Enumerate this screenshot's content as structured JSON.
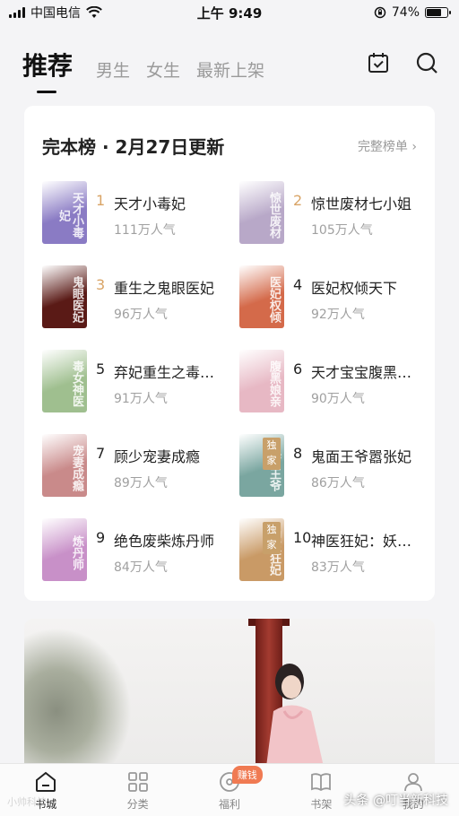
{
  "status_bar": {
    "carrier": "中国电信",
    "time": "上午 9:49",
    "battery": "74%",
    "battery_level": 0.74
  },
  "top_nav": {
    "tabs": [
      {
        "label": "推荐",
        "active": true
      },
      {
        "label": "男生",
        "active": false
      },
      {
        "label": "女生",
        "active": false
      },
      {
        "label": "最新上架",
        "active": false
      }
    ],
    "icons": [
      "calendar-check-icon",
      "search-icon"
    ]
  },
  "ranking": {
    "title": "完本榜 · 2月27日更新",
    "more_label": "完整榜单 ›",
    "books": [
      {
        "rank": "1",
        "name": "天才小毒妃",
        "popularity": "111万人气",
        "cover_text": "天才小毒妃",
        "cover_color": "#8a7bc4",
        "badge": ""
      },
      {
        "rank": "2",
        "name": "惊世废材七小姐",
        "popularity": "105万人气",
        "cover_text": "惊世废材",
        "cover_color": "#b8a8c8",
        "badge": ""
      },
      {
        "rank": "3",
        "name": "重生之鬼眼医妃",
        "popularity": "96万人气",
        "cover_text": "鬼眼医妃",
        "cover_color": "#5a1a16",
        "badge": ""
      },
      {
        "rank": "4",
        "name": "医妃权倾天下",
        "popularity": "92万人气",
        "cover_text": "医妃权倾",
        "cover_color": "#d46a4a",
        "badge": ""
      },
      {
        "rank": "5",
        "name": "弃妃重生之毒…",
        "popularity": "91万人气",
        "cover_text": "毒女神医",
        "cover_color": "#9fbf8f",
        "badge": ""
      },
      {
        "rank": "6",
        "name": "天才宝宝腹黑…",
        "popularity": "90万人气",
        "cover_text": "腹黑娘亲",
        "cover_color": "#e7b8c4",
        "badge": ""
      },
      {
        "rank": "7",
        "name": "顾少宠妻成瘾",
        "popularity": "89万人气",
        "cover_text": "宠妻成瘾",
        "cover_color": "#c98a8a",
        "badge": ""
      },
      {
        "rank": "8",
        "name": "鬼面王爷嚣张妃",
        "popularity": "86万人气",
        "cover_text": "鬼面王爷",
        "cover_color": "#7aa6a0",
        "badge": "独家"
      },
      {
        "rank": "9",
        "name": "绝色废柴炼丹师",
        "popularity": "84万人气",
        "cover_text": "炼丹师",
        "cover_color": "#c890c8",
        "badge": ""
      },
      {
        "rank": "10",
        "name": "神医狂妃：妖…",
        "popularity": "83万人气",
        "cover_text": "神医狂妃",
        "cover_color": "#c99a66",
        "badge": "独家"
      }
    ]
  },
  "bottom_nav": {
    "items": [
      {
        "label": "书城",
        "icon": "home-icon",
        "active": true
      },
      {
        "label": "分类",
        "icon": "grid-icon",
        "active": false
      },
      {
        "label": "福利",
        "icon": "coin-icon",
        "active": false,
        "badge": "赚钱"
      },
      {
        "label": "书架",
        "icon": "book-icon",
        "active": false
      },
      {
        "label": "我的",
        "icon": "user-icon",
        "active": false
      }
    ]
  },
  "watermark": "头条 @叮当新科技",
  "watermark_left": "小帅科技"
}
